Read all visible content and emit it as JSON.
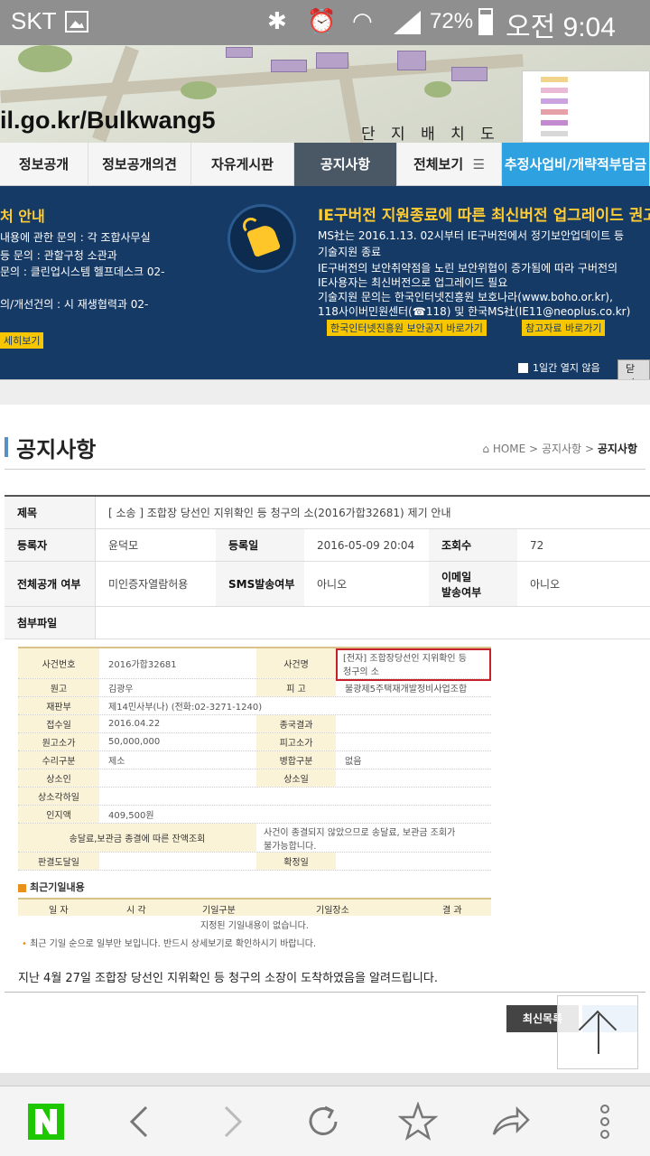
{
  "status_bar": {
    "carrier": "SKT",
    "battery": "72%",
    "time": "오전 9:04",
    "icons": [
      "gallery-icon",
      "bluetooth-icon",
      "alarm-icon",
      "wifi-icon",
      "signal-icon",
      "battery-charging-icon"
    ]
  },
  "banner": {
    "url": "il.go.kr/Bulkwang5",
    "map_caption": "단 지 배 치 도"
  },
  "nav": {
    "tabs": [
      "정보공개",
      "정보공개의견",
      "자유게시판",
      "공지사항",
      "전체보기",
      "추정사업비/개략적부담금"
    ],
    "active": "공지사항"
  },
  "popup_left": {
    "title": "처 안내",
    "lines": [
      "내용에 관한 문의 : 각 조합사무실",
      "등 문의 : 관할구청 소관과",
      "문의 : 클린업시스템 헬프데스크 02-",
      "의/개선건의 : 시 재생협력과 02-"
    ],
    "button": "세히보기"
  },
  "popup_right": {
    "title": "IE구버전 지원종료에 따른 최신버전 업그레이드 권고",
    "lines": [
      "MS社는 2016.1.13. 02시부터 IE구버전에서 정기보안업데이트 등",
      "기술지원 종료",
      "IE구버전의 보안취약점을 노린 보안위협이 증가됨에 따라 구버전의",
      "IE사용자는 최신버전으로 업그레이드 필요",
      "기술지원 문의는 한국인터넷진흥원 보호나라(www.boho.or.kr),",
      "118사이버민원센터(☎118) 및 한국MS社(IE11@neoplus.co.kr)"
    ],
    "button1": "한국인터넷진흥원 보안공지 바로가기",
    "button2": "참고자료 바로가기",
    "dont_show": "1일간 열지 않음",
    "close": "닫기"
  },
  "page": {
    "title": "공지사항",
    "breadcrumb": {
      "home": "HOME",
      "sep": ">",
      "level1": "공지사항",
      "current": "공지사항"
    }
  },
  "info": {
    "subject_label": "제목",
    "subject": "[ 소송 ] 조합장 당선인 지위확인 등 청구의 소(2016가합32681) 제기 안내",
    "author_label": "등록자",
    "author": "윤덕모",
    "date_label": "등록일",
    "date": "2016-05-09 20:04",
    "views_label": "조회수",
    "views": "72",
    "public_label": "전체공개 여부",
    "public": "미인증자열람허용",
    "sms_label": "SMS발송여부",
    "sms": "아니오",
    "email_label_1": "이메일",
    "email_label_2": "발송여부",
    "email": "아니오",
    "attach_label": "첨부파일",
    "attach": ""
  },
  "court": {
    "case_no_label": "사건번호",
    "case_no": "2016가합32681",
    "case_name_label": "사건명",
    "case_name_1": "[전자]  조합장당선인 지위확인 등",
    "case_name_2": "청구의 소",
    "plaintiff_label": "원고",
    "plaintiff": "김광우",
    "defendant_label": "피 고",
    "defendant": "불광제5주택재개발정비사업조합",
    "division_label": "재판부",
    "division": "제14민사부(나) (전화:02-3271-1240)",
    "filed_label": "접수일",
    "filed": "2016.04.22",
    "result_label": "종국결과",
    "result": "",
    "p_amount_label": "원고소가",
    "p_amount": "50,000,000",
    "d_amount_label": "피고소가",
    "d_amount": "",
    "type_label": "수리구분",
    "type": "제소",
    "merge_label": "병합구분",
    "merge": "없음",
    "appeal_label": "상소인",
    "appeal": "",
    "appeal_date_label": "상소일",
    "appeal_date": "",
    "appeal_dismiss_label": "상소각하일",
    "appeal_dismiss": "",
    "stamp_label": "인지액",
    "stamp": "409,500원",
    "balance_label": "송달료,보관금 종결에 따른 잔액조회",
    "balance_1": "사건이 종결되지 않았으므로 송달료, 보관금 조회가",
    "balance_2": "불가능합니다.",
    "delivery_label": "판결도달일",
    "delivery": "",
    "confirm_label": "확정일",
    "confirm": ""
  },
  "recent": {
    "title": "최근기일내용",
    "headers": [
      "일 자",
      "시 각",
      "기일구분",
      "기일장소",
      "결 과"
    ],
    "empty": "지정된 기일내용이 없습니다.",
    "note": "최근 기일 순으로 일부만 보입니다. 반드시 상세보기로 확인하시기 바랍니다."
  },
  "body_text": "지난 4월 27일 조합장 당선인 지위확인 등 청구의 소장이 도착하였음을 알려드립니다.",
  "buttons": {
    "list": "최신목록"
  },
  "browser": {
    "icons": [
      "naver-home-icon",
      "back-icon",
      "forward-icon",
      "refresh-icon",
      "bookmark-star-icon",
      "share-icon",
      "more-icon"
    ]
  }
}
